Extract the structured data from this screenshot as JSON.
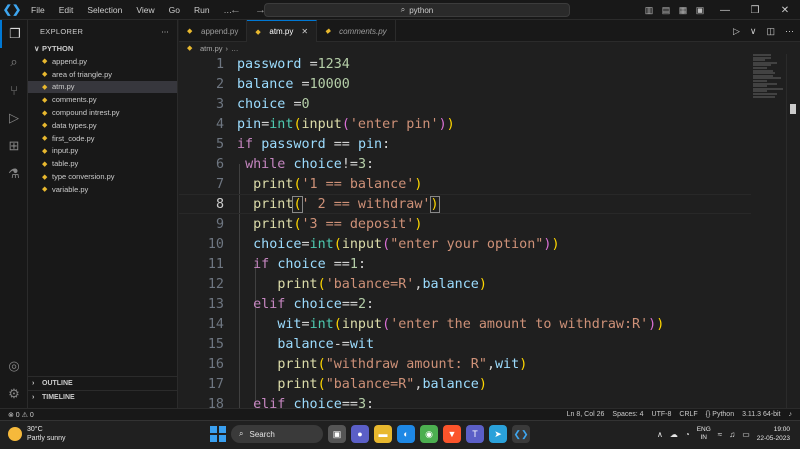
{
  "titlebar": {
    "menu": [
      "File",
      "Edit",
      "Selection",
      "View",
      "Go",
      "Run",
      "…"
    ],
    "search_text": "python",
    "window_controls": [
      "—",
      "❒",
      "✕"
    ]
  },
  "sidebar": {
    "header": "EXPLORER",
    "folder": "PYTHON",
    "files": [
      "append.py",
      "area of triangle.py",
      "atm.py",
      "comments.py",
      "compound intrest.py",
      "data types.py",
      "first_code.py",
      "input.py",
      "table.py",
      "type conversion.py",
      "variable.py"
    ],
    "active_file_index": 2,
    "outline_label": "OUTLINE",
    "timeline_label": "TIMELINE"
  },
  "tabs": [
    {
      "label": "append.py",
      "active": false,
      "italic": false
    },
    {
      "label": "atm.py",
      "active": true,
      "italic": false
    },
    {
      "label": "comments.py",
      "active": false,
      "italic": true
    }
  ],
  "breadcrumb": {
    "file": "atm.py",
    "rest": "…"
  },
  "editor": {
    "current_line": 8,
    "line_numbers": [
      "1",
      "2",
      "3",
      "4",
      "5",
      "6",
      "7",
      "8",
      "9",
      "10",
      "11",
      "12",
      "13",
      "14",
      "15",
      "16",
      "17",
      "18"
    ]
  },
  "statusbar": {
    "problems": "⊗ 0 ⚠ 0",
    "position": "Ln 8, Col 26",
    "spaces": "Spaces: 4",
    "encoding": "UTF-8",
    "eol": "CRLF",
    "language": "{} Python",
    "interpreter": "3.11.3 64-bit"
  },
  "taskbar": {
    "temp": "30°C",
    "weather": "Partly sunny",
    "search_label": "Search",
    "lang_line1": "ENG",
    "lang_line2": "IN",
    "time": "19:00",
    "date": "22-05-2023"
  },
  "colors": {
    "accent": "#0078d4",
    "keyword": "#c586c0",
    "function": "#dcdcaa",
    "string": "#ce9178",
    "number": "#b5cea8",
    "variable": "#9cdcfe"
  }
}
